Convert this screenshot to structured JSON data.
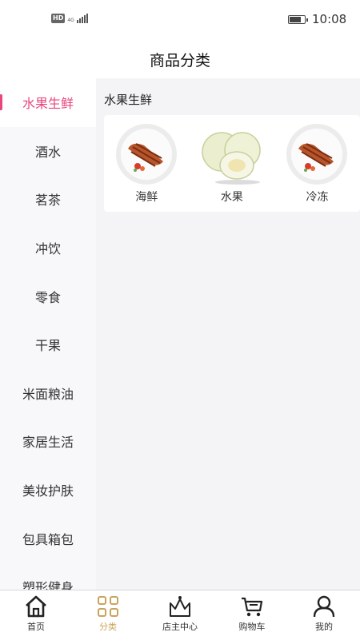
{
  "status": {
    "network_badge": "HD",
    "network_type": "4G",
    "time": "10:08",
    "battery_level": 0.85
  },
  "header": {
    "title": "商品分类"
  },
  "sidebar": {
    "items": [
      {
        "label": "水果生鲜"
      },
      {
        "label": "酒水"
      },
      {
        "label": "茗茶"
      },
      {
        "label": "冲饮"
      },
      {
        "label": "零食"
      },
      {
        "label": "干果"
      },
      {
        "label": "米面粮油"
      },
      {
        "label": "家居生活"
      },
      {
        "label": "美妆护肤"
      },
      {
        "label": "包具箱包"
      },
      {
        "label": "塑形健身"
      }
    ],
    "active_index": 0
  },
  "main": {
    "section_title": "水果生鲜",
    "categories": [
      {
        "label": "海鲜",
        "icon": "roast-meat-plate-image"
      },
      {
        "label": "水果",
        "icon": "melon-image"
      },
      {
        "label": "冷冻",
        "icon": "roast-meat-plate-image"
      }
    ]
  },
  "tabbar": {
    "items": [
      {
        "label": "首页",
        "icon": "home-icon"
      },
      {
        "label": "分类",
        "icon": "category-grid-icon"
      },
      {
        "label": "店主中心",
        "icon": "crown-icon"
      },
      {
        "label": "购物车",
        "icon": "cart-icon"
      },
      {
        "label": "我的",
        "icon": "user-icon"
      }
    ],
    "active_index": 1
  },
  "colors": {
    "accent": "#e8467c",
    "tab_active": "#c9a45c",
    "sidebar_bg": "#f8f7fa",
    "content_bg": "#f4f4f7"
  }
}
